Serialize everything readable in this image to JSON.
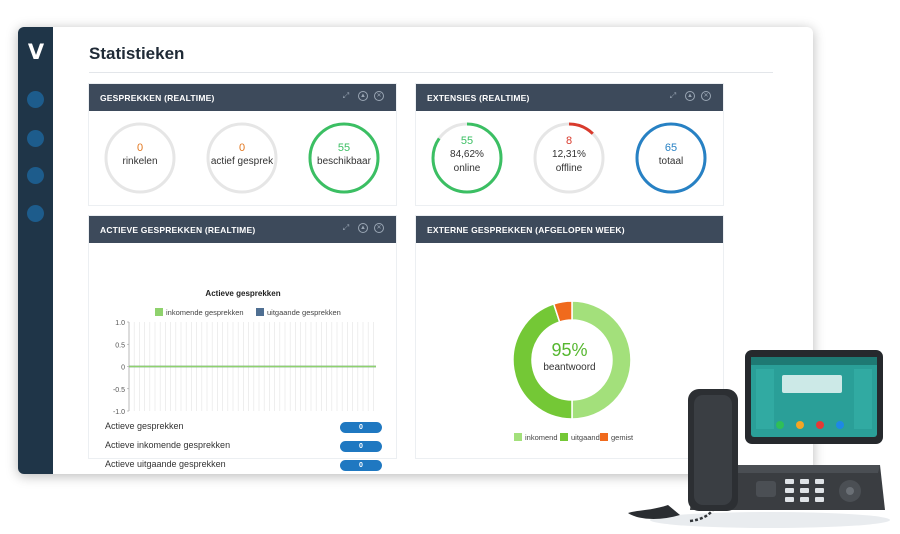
{
  "app": {
    "logo": "V",
    "title": "Statistieken"
  },
  "colors": {
    "sidebar": "#1f3548",
    "panel_header": "#3d4a5b",
    "green": "#3bbf63",
    "red": "#d93a2c",
    "blue": "#2781c4",
    "grey_ring": "#e6e6e6",
    "orange": "#e2771f"
  },
  "panels": {
    "gesprekken": {
      "title": "GESPREKKEN (REALTIME)",
      "gauges": [
        {
          "value": "0",
          "label": "rinkelen",
          "fraction": 0,
          "color": "#e2771f"
        },
        {
          "value": "0",
          "label": "actief gesprek",
          "fraction": 0,
          "color": "#e2771f"
        },
        {
          "value": "55",
          "label": "beschikbaar",
          "fraction": 1,
          "color": "#3bbf63"
        }
      ]
    },
    "extensies": {
      "title": "EXTENSIES (REALTIME)",
      "gauges": [
        {
          "value": "55",
          "percent": "84,62%",
          "label": "online",
          "fraction": 0.8462,
          "color": "#3bbf63"
        },
        {
          "value": "8",
          "percent": "12,31%",
          "label": "offline",
          "fraction": 0.1231,
          "color": "#d93a2c"
        },
        {
          "value": "65",
          "label": "totaal",
          "fraction": 1,
          "color": "#2781c4"
        }
      ]
    },
    "actieve": {
      "title": "ACTIEVE GESPREKKEN (REALTIME)",
      "stats": [
        {
          "label": "Actieve gesprekken",
          "value": "0"
        },
        {
          "label": "Actieve inkomende gesprekken",
          "value": "0"
        },
        {
          "label": "Actieve uitgaande gesprekken",
          "value": "0"
        }
      ]
    },
    "externe": {
      "title": "EXTERNE GESPREKKEN (AFGELOPEN WEEK)",
      "center_value": "95%",
      "center_label": "beantwoord"
    }
  },
  "chart_data": [
    {
      "type": "line",
      "title": "Actieve gesprekken",
      "ylim": [
        -1.0,
        1.0
      ],
      "y_ticks": [
        "1.0",
        "0.5",
        "0",
        "-0.5",
        "-1.0"
      ],
      "series": [
        {
          "name": "inkomende gesprekken",
          "color": "#8fd26d",
          "values": [
            0,
            0
          ]
        },
        {
          "name": "uitgaande gesprekken",
          "color": "#4f6f92",
          "values": [
            0,
            0
          ]
        }
      ],
      "grid": true,
      "legend": "top"
    },
    {
      "type": "pie",
      "labels": [
        "inkomend",
        "uitgaand",
        "gemist"
      ],
      "colors": [
        "#a3e07b",
        "#74c836",
        "#f06a1d"
      ],
      "values": [
        50,
        45,
        5
      ]
    }
  ]
}
